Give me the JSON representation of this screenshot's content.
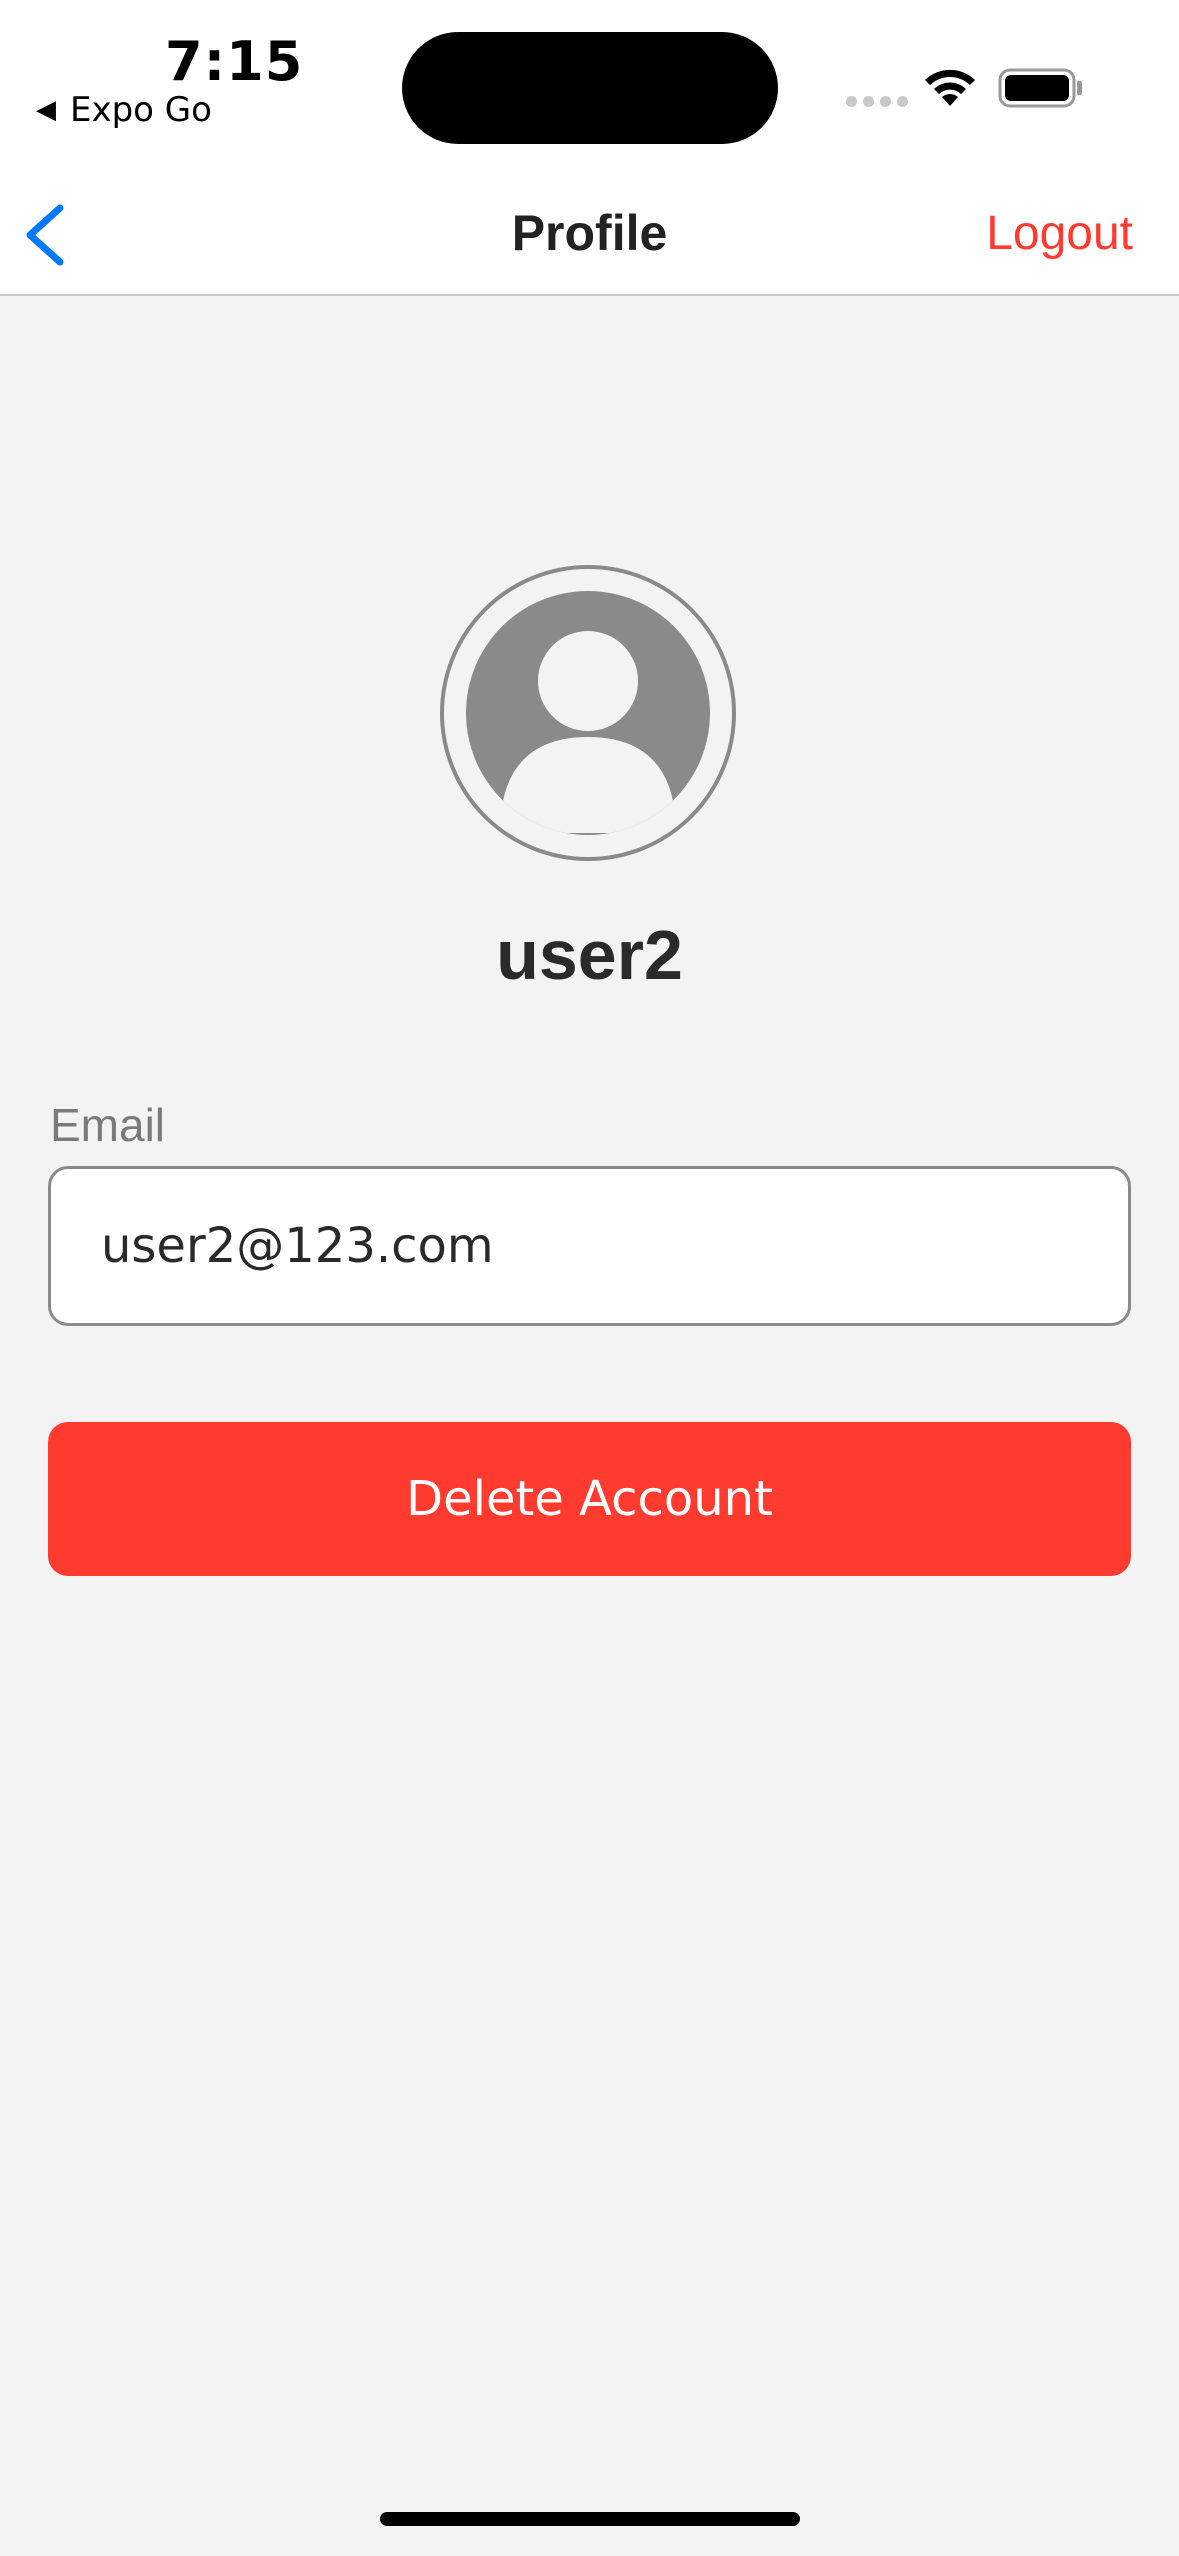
{
  "status_bar": {
    "time": "7:15",
    "back_app_label": "Expo Go"
  },
  "nav": {
    "title": "Profile",
    "logout_label": "Logout"
  },
  "profile": {
    "username": "user2",
    "email_label": "Email",
    "email_value": "user2@123.com",
    "delete_label": "Delete Account"
  },
  "colors": {
    "accent_blue": "#007aff",
    "destructive_red": "#ff3b30",
    "background": "#f3f3f3"
  },
  "icons": {
    "nav_back": "chevron-left-icon",
    "avatar": "user-avatar-icon",
    "wifi": "wifi-icon",
    "battery": "battery-icon"
  }
}
